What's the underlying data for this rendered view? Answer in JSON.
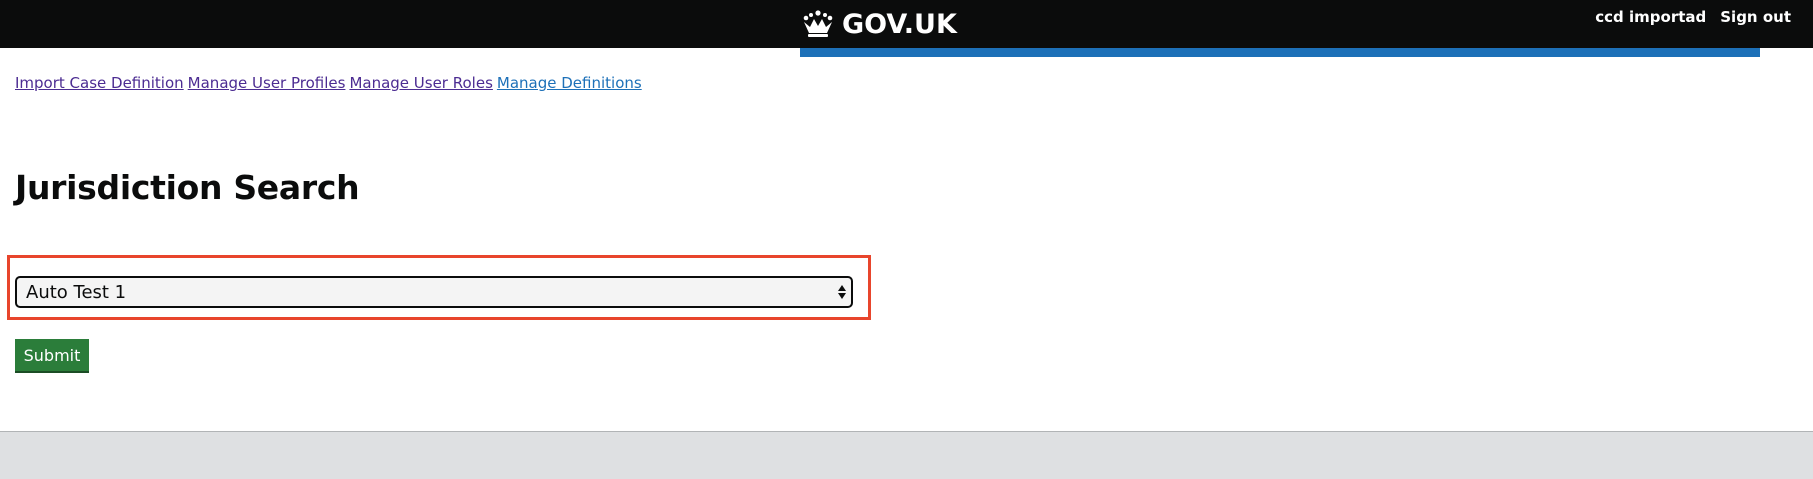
{
  "header": {
    "logo_text": "GOV.UK",
    "user_name": "ccd importad",
    "sign_out_label": "Sign out"
  },
  "nav": {
    "items": [
      {
        "label": "Import Case Definition"
      },
      {
        "label": "Manage User Profiles"
      },
      {
        "label": "Manage User Roles"
      },
      {
        "label": "Manage Definitions"
      }
    ]
  },
  "main": {
    "title": "Jurisdiction Search",
    "jurisdiction_select": {
      "selected": "Auto Test 1"
    },
    "submit_label": "Submit"
  },
  "colors": {
    "header_bg": "#0b0c0c",
    "accent_blue": "#1d70b8",
    "visited_link": "#4c2c92",
    "button_green": "#2b7d3a",
    "highlight_red": "#e8452c",
    "footer_bg": "#dee0e2"
  },
  "icons": {
    "logo": "crown-icon",
    "select": "select-arrows-icon"
  }
}
